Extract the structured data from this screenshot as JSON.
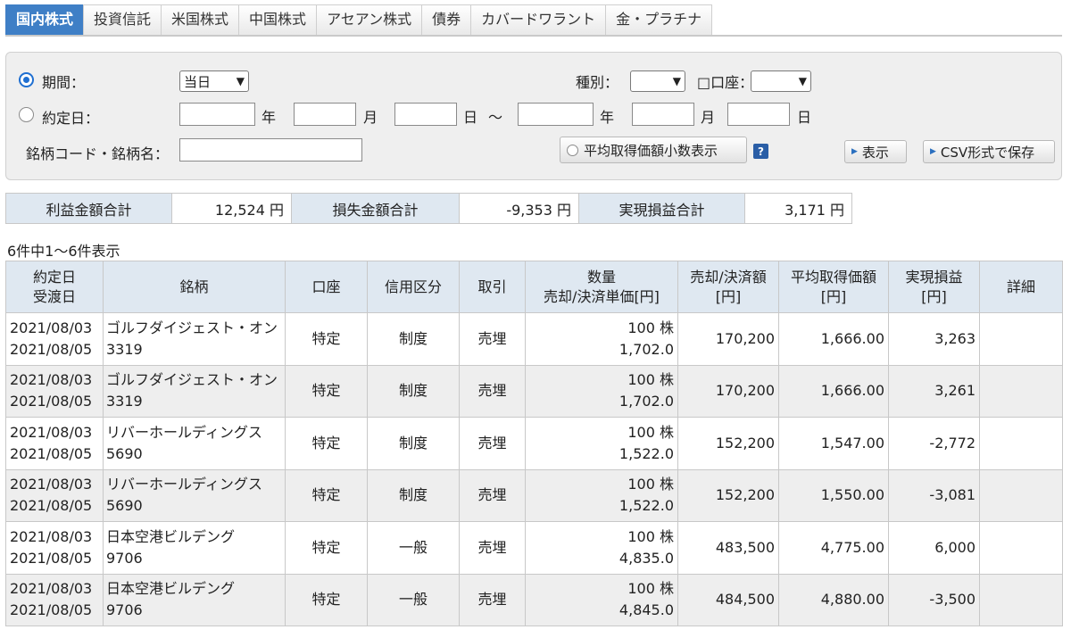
{
  "tabs": [
    {
      "label": "国内株式",
      "active": true
    },
    {
      "label": "投資信託",
      "active": false
    },
    {
      "label": "米国株式",
      "active": false
    },
    {
      "label": "中国株式",
      "active": false
    },
    {
      "label": "アセアン株式",
      "active": false
    },
    {
      "label": "債券",
      "active": false
    },
    {
      "label": "カバードワラント",
      "active": false
    },
    {
      "label": "金・プラチナ",
      "active": false
    }
  ],
  "search": {
    "period_label": "期間：",
    "period_value": "当日",
    "contract_date_label": "約定日：",
    "year": "年",
    "month": "月",
    "day": "日",
    "tilde": "～",
    "type_label": "種別：",
    "account_label": "口座：",
    "account_checkbox": "□",
    "code_label": "銘柄コード・銘柄名：",
    "avg_decimal_button": "平均取得価額小数表示",
    "help": "?",
    "show_button": "表示",
    "csv_button": "CSV形式で保存"
  },
  "summary": {
    "profit_label": "利益金額合計",
    "profit_value": "12,524 円",
    "loss_label": "損失金額合計",
    "loss_value": "-9,353 円",
    "realized_label": "実現損益合計",
    "realized_value": "3,171 円"
  },
  "count_text": "6件中1～6件表示",
  "table": {
    "headers": {
      "date1": "約定日",
      "date2": "受渡日",
      "name": "銘柄",
      "account": "口座",
      "credit": "信用区分",
      "trade": "取引",
      "qty1": "数量",
      "qty2": "売却/決済単価[円]",
      "amount1": "売却/決済額",
      "amount2": "[円]",
      "avg1": "平均取得価額",
      "avg2": "[円]",
      "pl1": "実現損益",
      "pl2": "[円]",
      "detail": "詳細"
    },
    "rows": [
      {
        "contract_date": "2021/08/03",
        "delivery_date": "2021/08/05",
        "name": "ゴルフダイジェスト・オン",
        "code": "3319",
        "account": "特定",
        "credit": "制度",
        "trade": "売埋",
        "qty": "100 株",
        "price": "1,702.0",
        "amount": "170,200",
        "avg": "1,666.00",
        "pl": "3,263"
      },
      {
        "contract_date": "2021/08/03",
        "delivery_date": "2021/08/05",
        "name": "ゴルフダイジェスト・オン",
        "code": "3319",
        "account": "特定",
        "credit": "制度",
        "trade": "売埋",
        "qty": "100 株",
        "price": "1,702.0",
        "amount": "170,200",
        "avg": "1,666.00",
        "pl": "3,261"
      },
      {
        "contract_date": "2021/08/03",
        "delivery_date": "2021/08/05",
        "name": "リバーホールディングス",
        "code": "5690",
        "account": "特定",
        "credit": "制度",
        "trade": "売埋",
        "qty": "100 株",
        "price": "1,522.0",
        "amount": "152,200",
        "avg": "1,547.00",
        "pl": "-2,772"
      },
      {
        "contract_date": "2021/08/03",
        "delivery_date": "2021/08/05",
        "name": "リバーホールディングス",
        "code": "5690",
        "account": "特定",
        "credit": "制度",
        "trade": "売埋",
        "qty": "100 株",
        "price": "1,522.0",
        "amount": "152,200",
        "avg": "1,550.00",
        "pl": "-3,081"
      },
      {
        "contract_date": "2021/08/03",
        "delivery_date": "2021/08/05",
        "name": "日本空港ビルデング",
        "code": "9706",
        "account": "特定",
        "credit": "一般",
        "trade": "売埋",
        "qty": "100 株",
        "price": "4,835.0",
        "amount": "483,500",
        "avg": "4,775.00",
        "pl": "6,000"
      },
      {
        "contract_date": "2021/08/03",
        "delivery_date": "2021/08/05",
        "name": "日本空港ビルデング",
        "code": "9706",
        "account": "特定",
        "credit": "一般",
        "trade": "売埋",
        "qty": "100 株",
        "price": "4,845.0",
        "amount": "484,500",
        "avg": "4,880.00",
        "pl": "-3,500"
      }
    ]
  },
  "colors": {
    "tab_active": "#3f7fc6",
    "header_bg": "#dfe8f1",
    "alt_row": "#eeeeee",
    "radio_accent": "#1f6fd1"
  }
}
